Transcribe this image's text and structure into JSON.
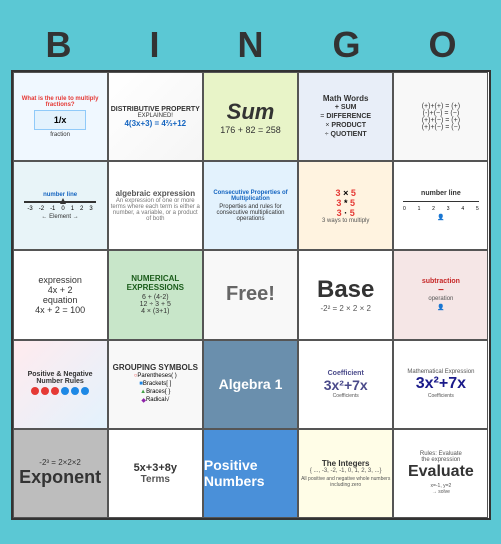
{
  "header": {
    "letters": [
      "B",
      "I",
      "N",
      "G",
      "O"
    ]
  },
  "grid": {
    "rows": [
      [
        {
          "id": "r1c1",
          "type": "image-card",
          "label": "fractions-card",
          "text": "",
          "subtext": "fraction diagram"
        },
        {
          "id": "r1c2",
          "type": "distributive",
          "label": "distributive-property",
          "title": "DISTRIBUTIVE PROPERTY",
          "subtitle": "EXPLAINED!",
          "equation": "4(3x+3) = 4⅔+12"
        },
        {
          "id": "r1c3",
          "type": "sum",
          "label": "sum-card",
          "mainText": "Sum",
          "equation": "176 + 82 = 258"
        },
        {
          "id": "r1c4",
          "type": "math-words",
          "label": "math-words-card",
          "title": "Math Words",
          "words": [
            "+ SUM",
            "= DIFFERENCE",
            "× PRODUCT",
            "÷ QUOTIENT"
          ]
        },
        {
          "id": "r1c5",
          "type": "equations",
          "label": "equations-card",
          "lines": [
            "(+)+(+) = (+)",
            "(-)+(−) = (−)",
            "(+)+(−) = (+)",
            "(+)+(−) = (−)"
          ]
        }
      ],
      [
        {
          "id": "r2c1",
          "type": "image-card",
          "label": "number-line-diagram",
          "text": "number line diagram"
        },
        {
          "id": "r2c2",
          "type": "algebraic-expression",
          "label": "algebraic-expression-card",
          "title": "algebraic expression",
          "lines": [
            "An expression of one or",
            "more terms where each",
            "term is either a number,",
            "a variable, or a product",
            "of both"
          ]
        },
        {
          "id": "r2c3",
          "type": "consecutive-properties",
          "label": "consecutive-properties-card",
          "title": "Consecutive Properties of Multiplication"
        },
        {
          "id": "r2c4",
          "type": "multiplication",
          "label": "multiplication-card",
          "rows": [
            "3 × 5",
            "3 * 5",
            "3 · 5"
          ]
        },
        {
          "id": "r2c5",
          "type": "number-line",
          "label": "number-line-card",
          "title": "number line"
        }
      ],
      [
        {
          "id": "r3c1",
          "type": "expression",
          "label": "expression-equation-card",
          "expression": "expression",
          "expressionEx": "4x + 2",
          "equation": "equation",
          "equationEx": "4x + 2 = 100"
        },
        {
          "id": "r3c2",
          "type": "numerical",
          "label": "numerical-expressions-card",
          "title": "NUMERICAL EXPRESSIONS"
        },
        {
          "id": "r3c3",
          "type": "free",
          "label": "free-space",
          "text": "Free!"
        },
        {
          "id": "r3c4",
          "type": "base",
          "label": "base-card",
          "mainText": "Base",
          "equation": "-2² = 2 × 2 × 2"
        },
        {
          "id": "r3c5",
          "type": "image-card",
          "label": "subtraction-card",
          "text": "subtraction"
        }
      ],
      [
        {
          "id": "r4c1",
          "type": "number-rules",
          "label": "positive-negative-number-rules",
          "title": "Positive & Negative",
          "subtitle": "Number Rules"
        },
        {
          "id": "r4c2",
          "type": "grouping",
          "label": "grouping-symbols-card",
          "title": "GROUPING SYMBOLS",
          "items": [
            "Parentheses",
            "Brackets",
            "Braces",
            "Radical"
          ]
        },
        {
          "id": "r4c3",
          "type": "algebra",
          "label": "algebra1-card",
          "text": "Algebra 1"
        },
        {
          "id": "r4c4",
          "type": "coefficient",
          "label": "coefficient-card",
          "title": "Coefficient",
          "equation": "3x² + 7x"
        },
        {
          "id": "r4c5",
          "type": "math-expression",
          "label": "mathematical-expression-card",
          "title": "Mathematical Expression",
          "equation": "3x² + 7x"
        }
      ],
      [
        {
          "id": "r5c1",
          "type": "exponent",
          "label": "exponent-card",
          "mainText": "Exponent",
          "equation": "-2³ = 2 × 2 × 2"
        },
        {
          "id": "r5c2",
          "type": "terms",
          "label": "terms-card",
          "equation": "5x + 3 + 8y",
          "label_text": "Terms"
        },
        {
          "id": "r5c3",
          "type": "positive-numbers",
          "label": "positive-numbers-card",
          "text": "Positive Numbers"
        },
        {
          "id": "r5c4",
          "type": "integers",
          "label": "integers-card",
          "title": "The Integers",
          "content": "{ ..., -3, -2, -1, 0, 1, 2, 3, ...}"
        },
        {
          "id": "r5c5",
          "type": "evaluate",
          "label": "evaluate-card",
          "text": "Evaluate"
        }
      ]
    ]
  }
}
